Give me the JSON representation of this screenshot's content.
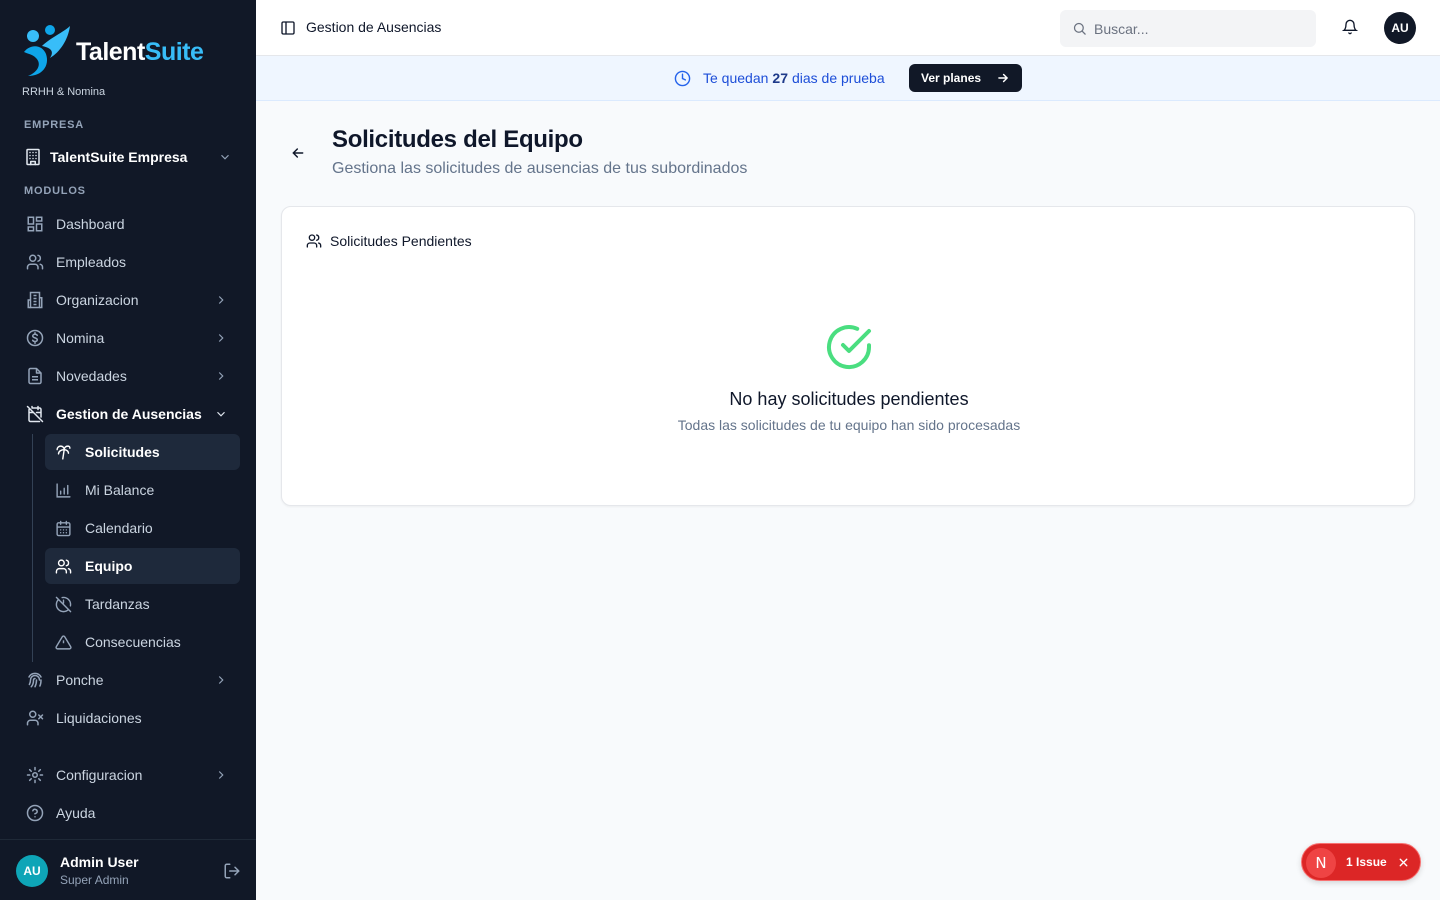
{
  "brand": {
    "name_part1": "Talent",
    "name_part2": "Suite",
    "subtitle": "RRHH & Nomina"
  },
  "sidebar": {
    "company_label": "EMPRESA",
    "company_name": "TalentSuite Empresa",
    "modules_label": "MODULOS",
    "items": [
      {
        "label": "Dashboard",
        "icon": "dashboard-icon"
      },
      {
        "label": "Empleados",
        "icon": "users-icon"
      },
      {
        "label": "Organizacion",
        "icon": "building-icon"
      },
      {
        "label": "Nomina",
        "icon": "dollar-icon"
      },
      {
        "label": "Novedades",
        "icon": "file-icon"
      },
      {
        "label": "Gestion de Ausencias",
        "icon": "calendar-off-icon"
      },
      {
        "label": "Ponche",
        "icon": "fingerprint-icon"
      },
      {
        "label": "Liquidaciones",
        "icon": "user-x-icon"
      },
      {
        "label": "Configuracion",
        "icon": "gear-icon"
      },
      {
        "label": "Ayuda",
        "icon": "help-icon"
      }
    ],
    "sub_items": [
      {
        "label": "Solicitudes",
        "icon": "palm-tree-icon"
      },
      {
        "label": "Mi Balance",
        "icon": "bar-chart-icon"
      },
      {
        "label": "Calendario",
        "icon": "calendar-icon"
      },
      {
        "label": "Equipo",
        "icon": "users-icon"
      },
      {
        "label": "Tardanzas",
        "icon": "clock-off-icon"
      },
      {
        "label": "Consecuencias",
        "icon": "warning-icon"
      }
    ],
    "user": {
      "initials": "AU",
      "name": "Admin User",
      "role": "Super Admin"
    }
  },
  "header": {
    "title": "Gestion de Ausencias",
    "search_placeholder": "Buscar...",
    "avatar_initials": "AU"
  },
  "banner": {
    "text_before": "Te quedan",
    "days": "27",
    "text_after": "dias de prueba",
    "button_label": "Ver planes"
  },
  "page": {
    "title": "Solicitudes del Equipo",
    "subtitle": "Gestiona las solicitudes de ausencias de tus subordinados"
  },
  "card": {
    "title": "Solicitudes Pendientes",
    "empty_title": "No hay solicitudes pendientes",
    "empty_subtitle": "Todas las solicitudes de tu equipo han sido procesadas"
  },
  "issue": {
    "badge": "N",
    "label": "1 Issue"
  },
  "colors": {
    "sidebar_bg": "#111827",
    "accent": "#38bdf8",
    "success": "#4ade80",
    "danger": "#dc2626"
  }
}
